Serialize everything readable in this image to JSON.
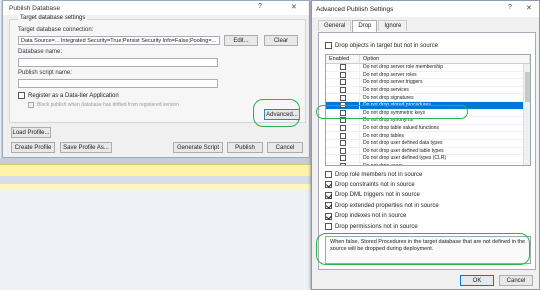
{
  "publish_dialog": {
    "title": "Publish Database",
    "help_glyph": "?",
    "close_glyph": "✕",
    "group_label": "Target database settings",
    "connection_label": "Target database connection:",
    "connection_value": "Data Source=... Integrated Security=True;Persist Security Info=False;Pooling=...",
    "edit_label": "Edit...",
    "clear_label": "Clear",
    "db_name_label": "Database name:",
    "db_name_value": "",
    "script_name_label": "Publish script name:",
    "script_name_value": "",
    "register_label": "Register as a Data-tier Application",
    "block_label": "Block publish when database has drifted from registered version",
    "advanced_label": "Advanced...",
    "load_profile_label": "Load Profile...",
    "create_profile_label": "Create Profile",
    "save_profile_label": "Save Profile As...",
    "generate_script_label": "Generate Script",
    "publish_label": "Publish",
    "cancel_label": "Cancel"
  },
  "advanced_dialog": {
    "title": "Advanced Publish Settings",
    "help_glyph": "?",
    "close_glyph": "✕",
    "tabs": [
      {
        "label": "General",
        "active": false
      },
      {
        "label": "Drop",
        "active": true
      },
      {
        "label": "Ignore",
        "active": false
      }
    ],
    "drop_objects_label": "Drop objects in target but not in source",
    "drop_objects_checked": false,
    "grid_headers": [
      "Enabled",
      "Option"
    ],
    "grid_rows": [
      {
        "checked": false,
        "label": "Do not drop server role membership",
        "selected": false
      },
      {
        "checked": false,
        "label": "Do not drop server roles",
        "selected": false
      },
      {
        "checked": false,
        "label": "Do not drop server triggers",
        "selected": false
      },
      {
        "checked": false,
        "label": "Do not drop services",
        "selected": false
      },
      {
        "checked": false,
        "label": "Do not drop signatures",
        "selected": false
      },
      {
        "checked": false,
        "label": "Do not drop stored procedures",
        "selected": true
      },
      {
        "checked": false,
        "label": "Do not drop symmetric keys",
        "selected": false
      },
      {
        "checked": false,
        "label": "Do not drop synonyms",
        "selected": false
      },
      {
        "checked": false,
        "label": "Do not drop table valued functions",
        "selected": false
      },
      {
        "checked": false,
        "label": "Do not drop tables",
        "selected": false
      },
      {
        "checked": false,
        "label": "Do not drop user defined data types",
        "selected": false
      },
      {
        "checked": false,
        "label": "Do not drop user defined table types",
        "selected": false
      },
      {
        "checked": false,
        "label": "Do not drop user defined types (CLR)",
        "selected": false
      },
      {
        "checked": false,
        "label": "Do not drop users",
        "selected": false
      }
    ],
    "options": [
      {
        "label": "Drop role members not in source",
        "checked": false
      },
      {
        "label": "Drop constraints not in source",
        "checked": true
      },
      {
        "label": "Drop DML triggers not in source",
        "checked": true
      },
      {
        "label": "Drop extended properties not in source",
        "checked": true
      },
      {
        "label": "Drop indexes not in source",
        "checked": true
      },
      {
        "label": "Drop permissions not in source",
        "checked": false
      }
    ],
    "description": "When false, Stored Procedures in the target database that are not defined in the source will be dropped during deployment.",
    "ok_label": "OK",
    "cancel_label": "Cancel"
  },
  "colors": {
    "highlight_ring": "#2bb24c",
    "selection": "#0078d7"
  }
}
